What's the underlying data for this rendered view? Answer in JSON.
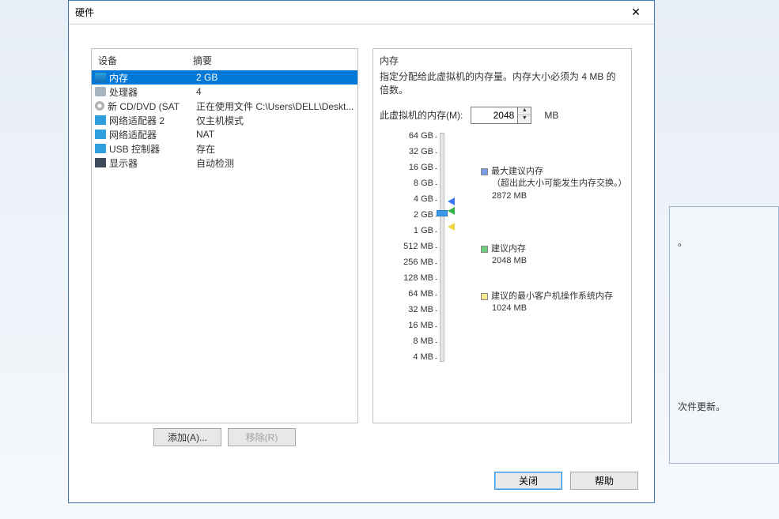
{
  "bg": {
    "text1": "。",
    "text2": "次件更新。"
  },
  "dialog": {
    "title": "硬件"
  },
  "device_headers": {
    "device": "设备",
    "summary": "摘要"
  },
  "devices": [
    {
      "name": "内存",
      "summary": "2 GB",
      "icon": "mem",
      "selected": true
    },
    {
      "name": "处理器",
      "summary": "4",
      "icon": "cpu"
    },
    {
      "name": "新 CD/DVD (SAT",
      "summary": "正在使用文件 C:\\Users\\DELL\\Deskt...",
      "icon": "cd"
    },
    {
      "name": "网络适配器 2",
      "summary": "仅主机模式",
      "icon": "net"
    },
    {
      "name": "网络适配器",
      "summary": "NAT",
      "icon": "net"
    },
    {
      "name": "USB 控制器",
      "summary": "存在",
      "icon": "usb"
    },
    {
      "name": "显示器",
      "summary": "自动检测",
      "icon": "disp"
    }
  ],
  "buttons": {
    "add": "添加(A)...",
    "remove": "移除(R)",
    "close": "关闭",
    "help": "帮助"
  },
  "right": {
    "title": "内存",
    "desc": "指定分配给此虚拟机的内存量。内存大小必须为 4 MB 的倍数。",
    "mem_label": "此虚拟机的内存(M):",
    "mem_value": "2048",
    "unit": "MB"
  },
  "ticks": [
    "64 GB",
    "32 GB",
    "16 GB",
    "8 GB",
    "4 GB",
    "2 GB",
    "1 GB",
    "512 MB",
    "256 MB",
    "128 MB",
    "64 MB",
    "32 MB",
    "16 MB",
    "8 MB",
    "4 MB"
  ],
  "legend": {
    "max_title": "最大建议内存",
    "max_note": "（超出此大小可能发生内存交换。）",
    "max_val": "2872 MB",
    "rec_title": "建议内存",
    "rec_val": "2048 MB",
    "min_title": "建议的最小客户机操作系统内存",
    "min_val": "1024 MB"
  }
}
